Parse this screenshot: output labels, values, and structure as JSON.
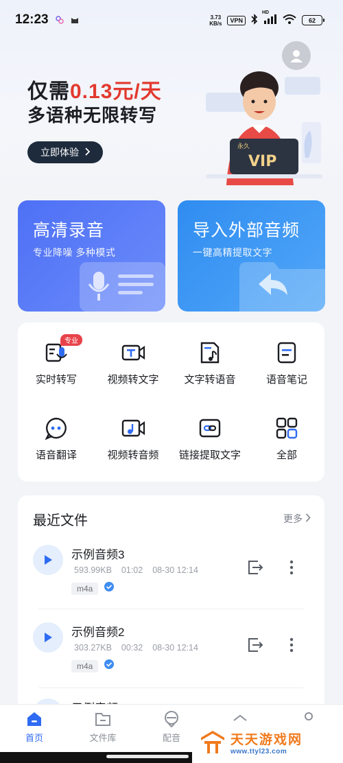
{
  "status_bar": {
    "time": "12:23",
    "net_speed_value": "3.73",
    "net_speed_unit": "KB/s",
    "vpn": "VPN",
    "hd": "HD",
    "battery": "62"
  },
  "hero": {
    "line1_prefix": "仅需",
    "line1_price": "0.13元/天",
    "line2": "多语种无限转写",
    "cta": "立即体验",
    "vip_small": "永久",
    "vip_big": "VIP"
  },
  "big_cards": {
    "record": {
      "title": "高清录音",
      "subtitle": "专业降噪 多种模式"
    },
    "import": {
      "title": "导入外部音频",
      "subtitle": "一键高精提取文字"
    }
  },
  "tools": [
    {
      "label": "实时转写",
      "badge": "专业",
      "icon": "realtime-transcribe-icon"
    },
    {
      "label": "视频转文字",
      "icon": "video-to-text-icon"
    },
    {
      "label": "文字转语音",
      "icon": "text-to-speech-icon"
    },
    {
      "label": "语音笔记",
      "icon": "voice-note-icon"
    },
    {
      "label": "语音翻译",
      "icon": "voice-translate-icon"
    },
    {
      "label": "视频转音频",
      "icon": "video-to-audio-icon"
    },
    {
      "label": "链接提取文字",
      "icon": "link-extract-icon"
    },
    {
      "label": "全部",
      "icon": "grid-all-icon"
    }
  ],
  "recent": {
    "title": "最近文件",
    "more": "更多",
    "files": [
      {
        "name": "示例音频3",
        "size": "593.99KB",
        "duration": "01:02",
        "date": "08-30 12:14",
        "format": "m4a"
      },
      {
        "name": "示例音频2",
        "size": "303.27KB",
        "duration": "00:32",
        "date": "08-30 12:14",
        "format": "m4a"
      },
      {
        "name": "示例音频"
      }
    ]
  },
  "nav": {
    "items": [
      {
        "label": "首页",
        "active": true
      },
      {
        "label": "文件库"
      },
      {
        "label": "配音"
      }
    ]
  },
  "watermark": {
    "name": "天天游戏网",
    "url": "www.ttyl23.com"
  },
  "colors": {
    "accent": "#2f6bf2",
    "price_red": "#e23a2e",
    "record_card": "#4e70f5",
    "import_card": "#2f8cf0"
  }
}
